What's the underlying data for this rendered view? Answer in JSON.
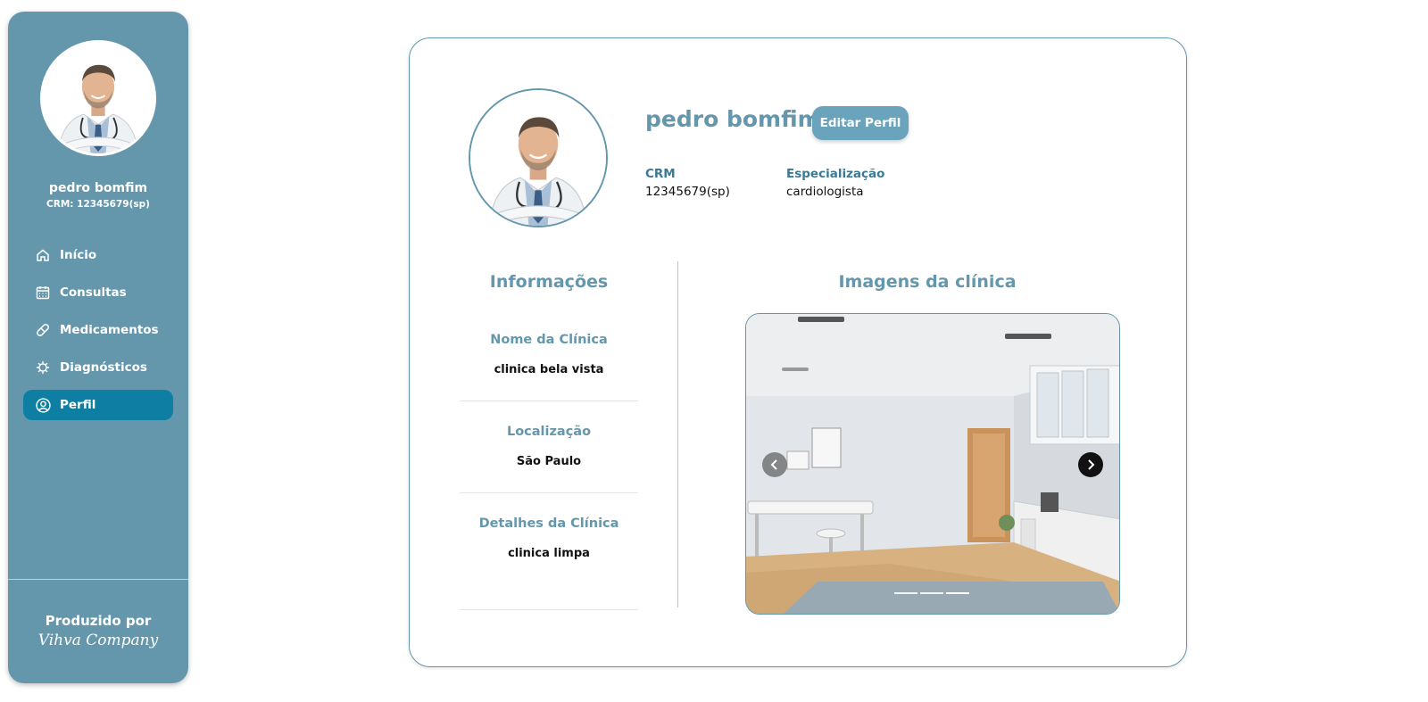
{
  "sidebar": {
    "user_name": "pedro bomfim",
    "user_crm": "CRM: 12345679(sp)",
    "nav": [
      {
        "label": "Início",
        "icon": "home-icon",
        "active": false
      },
      {
        "label": "Consultas",
        "icon": "calendar-icon",
        "active": false
      },
      {
        "label": "Medicamentos",
        "icon": "pill-icon",
        "active": false
      },
      {
        "label": "Diagnósticos",
        "icon": "virus-icon",
        "active": false
      },
      {
        "label": "Perfil",
        "icon": "user-circle-icon",
        "active": true
      }
    ],
    "footer_line1": "Produzido por",
    "footer_line2": "Vihva Company"
  },
  "profile": {
    "name": "pedro bomfim",
    "edit_label": "Editar Perfil",
    "crm_label": "CRM",
    "crm_value": "12345679(sp)",
    "spec_label": "Especialização",
    "spec_value": "cardiologista"
  },
  "info": {
    "title": "Informações",
    "clinic_name_label": "Nome da Clínica",
    "clinic_name_value": "clinica bela vista",
    "location_label": "Localização",
    "location_value": "São Paulo",
    "details_label": "Detalhes da Clínica",
    "details_value": "clinica limpa"
  },
  "gallery": {
    "title": "Imagens da clínica",
    "slide_count": 3,
    "active_slide": 3
  },
  "colors": {
    "sidebar_bg": "#6597ac",
    "nav_active": "#0e7ea3",
    "accent": "#6597ac",
    "button_bg": "#6aa3bc"
  }
}
